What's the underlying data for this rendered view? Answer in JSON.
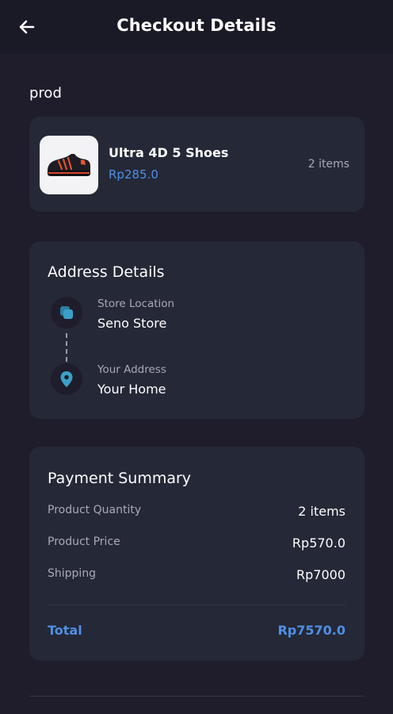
{
  "header": {
    "title": "Checkout Details",
    "back_icon": "arrow-left-icon"
  },
  "section_label": "prod",
  "product": {
    "name": "Ultra 4D 5 Shoes",
    "price": "Rp285.0",
    "quantity": "2 items",
    "image_icon": "shoe-icon"
  },
  "address": {
    "title": "Address Details",
    "store_label": "Store Location",
    "store_value": "Seno Store",
    "store_icon": "store-icon",
    "your_label": "Your Address",
    "your_value": "Your Home",
    "your_icon": "location-pin-icon"
  },
  "payment": {
    "title": "Payment Summary",
    "rows": [
      {
        "label": "Product Quantity",
        "value": "2 items"
      },
      {
        "label": "Product Price",
        "value": "Rp570.0"
      },
      {
        "label": "Shipping",
        "value": "Rp7000"
      }
    ],
    "total_label": "Total",
    "total_value": "Rp7570.0"
  },
  "colors": {
    "background": "#1f1d2b",
    "card": "#252836",
    "accent": "#4f8fe6",
    "icon_accent": "#3aa0c8",
    "muted_text": "#a9a9b7"
  }
}
